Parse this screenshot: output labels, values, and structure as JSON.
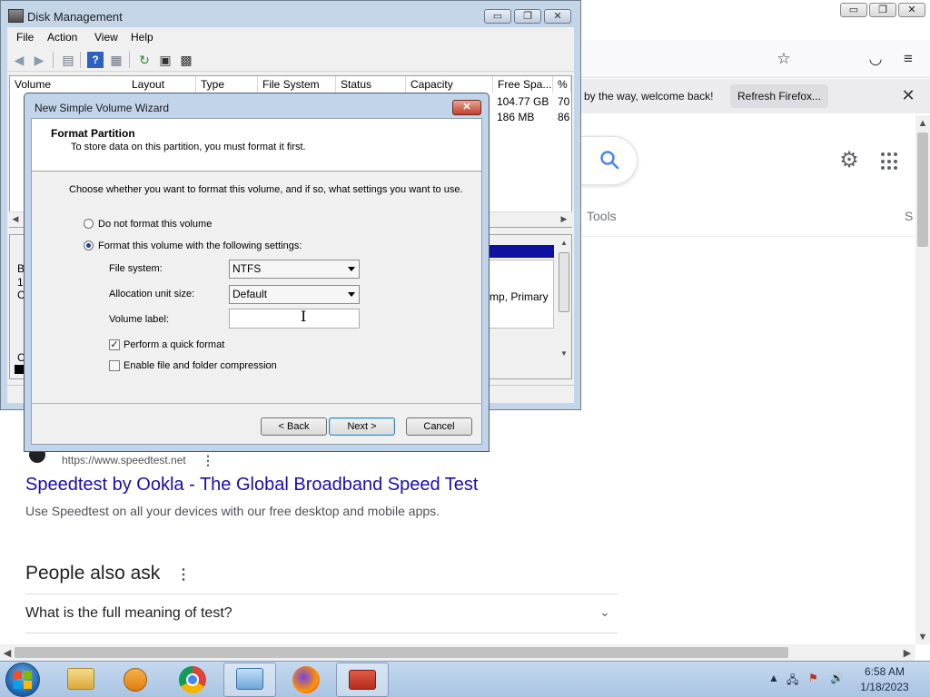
{
  "firefox": {
    "caption_buttons": {
      "minimize": "▭",
      "restore": "❐",
      "close": "✕"
    },
    "toolbar_icons": {
      "bookmark_star": "☆",
      "pocket": "◡",
      "menu": "≡"
    },
    "notification": {
      "text": "by the way, welcome back!",
      "button": "Refresh Firefox...",
      "close": "✕"
    },
    "scroll": {
      "up": "▲",
      "down": "▼",
      "left": "◀",
      "right": "▶"
    }
  },
  "google": {
    "tools_label": "Tools",
    "partial_label": "S",
    "result": {
      "url": "https://www.speedtest.net",
      "title": "Speedtest by Ookla - The Global Broadband Speed Test",
      "snippet": "Use Speedtest on all your devices with our free desktop and mobile apps."
    },
    "people_also_ask": {
      "title": "People also ask",
      "questions": [
        "What is the full meaning of test?"
      ]
    }
  },
  "disk_management": {
    "title": "Disk Management",
    "caption_buttons": {
      "minimize": "▭",
      "restore": "❐",
      "close": "✕"
    },
    "menu": [
      "File",
      "Action",
      "View",
      "Help"
    ],
    "columns": [
      "Volume",
      "Layout",
      "Type",
      "File System",
      "Status",
      "Capacity",
      "Free Spa...",
      "% F"
    ],
    "rows": [
      {
        "free_space": "104.77 GB",
        "pct_free": "70"
      },
      {
        "free_space": "186 MB",
        "pct_free": "86"
      }
    ],
    "graph_left_fragments": [
      "B",
      "1",
      "C",
      "C"
    ],
    "partition_label": "mp, Primary"
  },
  "wizard": {
    "title": "New Simple Volume Wizard",
    "close": "✕",
    "header_title": "Format Partition",
    "header_subtitle": "To store data on this partition, you must format it first.",
    "instruction": "Choose whether you want to format this volume, and if so, what settings you want to use.",
    "option_no_format": "Do not format this volume",
    "option_format": "Format this volume with the following settings:",
    "selected_option": "format",
    "file_system": {
      "label": "File system:",
      "value": "NTFS"
    },
    "allocation_unit": {
      "label": "Allocation unit size:",
      "value": "Default"
    },
    "volume_label": {
      "label": "Volume label:",
      "value": ""
    },
    "quick_format": {
      "label": "Perform a quick format",
      "checked": true
    },
    "compression": {
      "label": "Enable file and folder compression",
      "checked": false
    },
    "buttons": {
      "back": "< Back",
      "next": "Next >",
      "cancel": "Cancel"
    }
  },
  "taskbar": {
    "clock_time": "6:58 AM",
    "clock_date": "1/18/2023"
  }
}
